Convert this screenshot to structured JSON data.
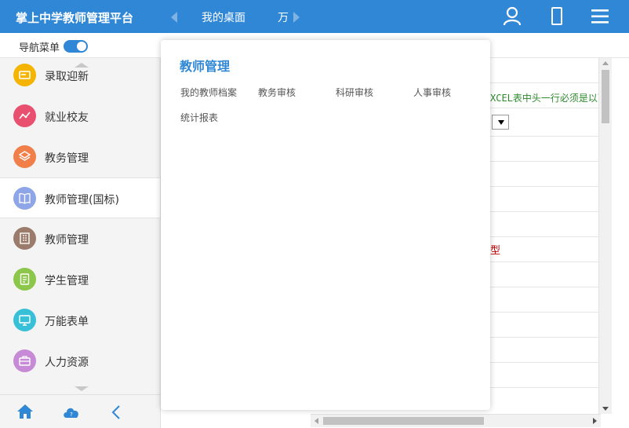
{
  "header": {
    "app_title": "掌上中学教师管理平台",
    "tabs": [
      "我的桌面",
      "万"
    ],
    "icons": [
      "user-icon",
      "mobile-icon",
      "menu-icon"
    ],
    "bg_color": "#2f87d6"
  },
  "nav_toggle": {
    "label": "导航菜单",
    "enabled": true
  },
  "sidebar": {
    "items": [
      {
        "label": "录取迎新",
        "icon": "enroll-icon",
        "color": "#f4b400"
      },
      {
        "label": "就业校友",
        "icon": "trend-icon",
        "color": "#e94f6f"
      },
      {
        "label": "教务管理",
        "icon": "layers-icon",
        "color": "#f07f4a"
      },
      {
        "label": "教师管理(国标)",
        "icon": "book-icon",
        "color": "#8ea6e8",
        "active": true
      },
      {
        "label": "教师管理",
        "icon": "building-icon",
        "color": "#9b7b6b"
      },
      {
        "label": "学生管理",
        "icon": "document-icon",
        "color": "#8cc64a"
      },
      {
        "label": "万能表单",
        "icon": "monitor-icon",
        "color": "#38c0d8"
      },
      {
        "label": "人力资源",
        "icon": "briefcase-icon",
        "color": "#c68ad6"
      }
    ],
    "footer_icons": [
      "home-icon",
      "help-cloud-icon",
      "collapse-icon"
    ]
  },
  "flyout": {
    "title": "教师管理",
    "links": [
      "我的教师档案",
      "教务审核",
      "科研审核",
      "人事审核",
      "统计报表"
    ]
  },
  "background": {
    "notice_text": "XCEL表中头一行必须是以下",
    "type_text": "型"
  }
}
